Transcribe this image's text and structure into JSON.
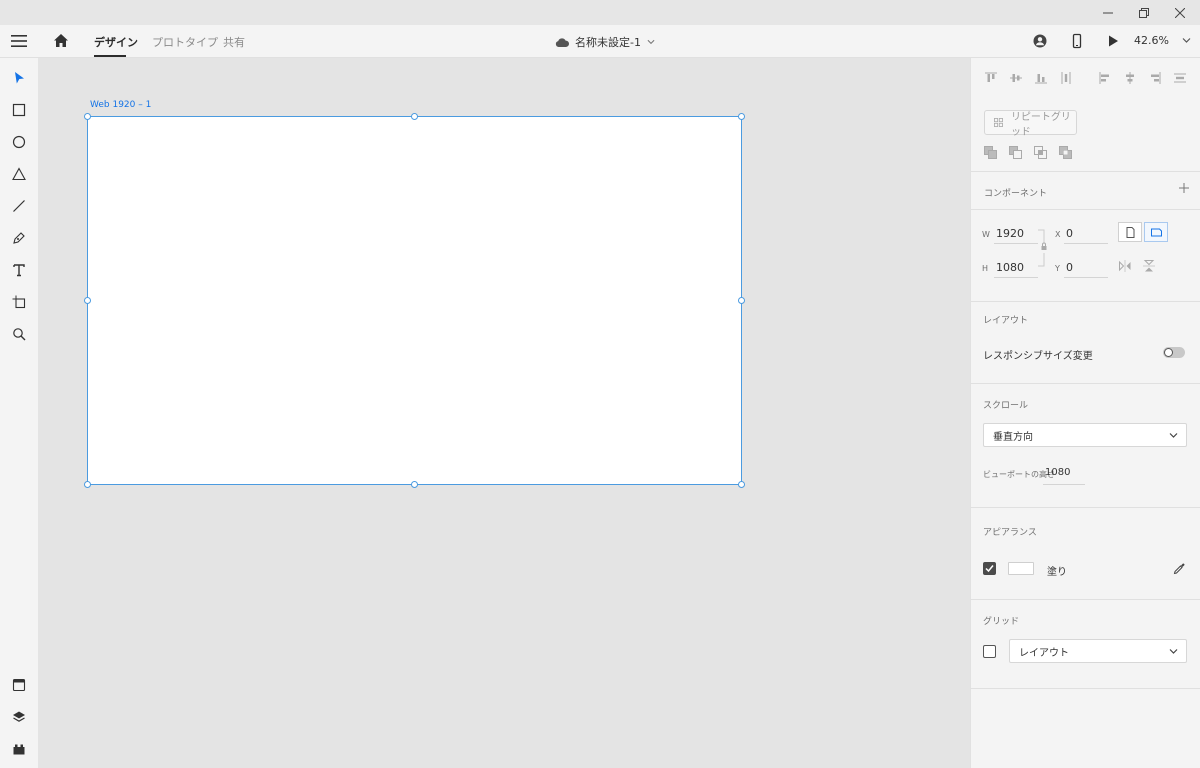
{
  "window": {
    "controls": {
      "minimize": "minimize-icon",
      "restore": "restore-icon",
      "close": "close-icon"
    }
  },
  "header": {
    "tabs": [
      {
        "label": "デザイン",
        "active": true
      },
      {
        "label": "プロトタイプ",
        "active": false
      },
      {
        "label": "共有",
        "active": false
      }
    ],
    "document_title": "名称未設定-1",
    "zoom": "42.6%",
    "icons": [
      "hamburger-menu-icon",
      "home-icon",
      "cloud-icon",
      "user-icon",
      "mobile-preview-icon",
      "play-icon",
      "chevron-down-icon"
    ]
  },
  "toolbar": {
    "tools": [
      "select-tool",
      "rectangle-tool",
      "ellipse-tool",
      "polygon-tool",
      "line-tool",
      "pen-tool",
      "text-tool",
      "artboard-tool",
      "zoom-tool"
    ],
    "bottom": [
      "assets-panel",
      "layers-panel",
      "plugins-panel"
    ]
  },
  "canvas": {
    "artboard_label": "Web 1920 – 1"
  },
  "inspector": {
    "repeat_grid_label": "リピートグリッド",
    "components_title": "コンポーネント",
    "w_label": "W",
    "w_value": "1920",
    "h_label": "H",
    "h_value": "1080",
    "x_label": "X",
    "x_value": "0",
    "y_label": "Y",
    "y_value": "0",
    "layout_title": "レイアウト",
    "responsive_label": "レスポンシブサイズ変更",
    "responsive_on": false,
    "scroll_title": "スクロール",
    "scroll_value": "垂直方向",
    "viewport_label": "ビューポートの高さ",
    "viewport_value": "1080",
    "appearance_title": "アピアランス",
    "fill_label": "塗り",
    "fill_checked": true,
    "fill_color": "#ffffff",
    "grid_title": "グリッド",
    "grid_value": "レイアウト",
    "grid_checked": false
  },
  "colors": {
    "accent": "#1473e6",
    "selection": "#4b9be0"
  }
}
